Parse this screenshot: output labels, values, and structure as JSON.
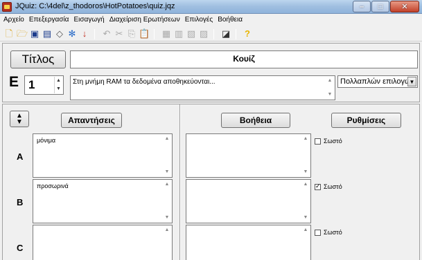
{
  "window": {
    "title": "JQuiz: C:\\4del\\z_thodoros\\HotPotatoes\\quiz.jqz",
    "minimize": "–",
    "maximize": "□",
    "close": "✕"
  },
  "menu": [
    {
      "label": "Αρχείο"
    },
    {
      "label": "Επεξεργασία"
    },
    {
      "label": "Εισαγωγή"
    },
    {
      "label": "Διαχείριση Ερωτήσεων"
    },
    {
      "label": "Επιλογές"
    },
    {
      "label": "Βοήθεια"
    }
  ],
  "toolbar": {
    "icons": [
      "new-file-icon",
      "open-folder-icon",
      "save-icon",
      "save-as-icon",
      "eraser-icon",
      "web-export-icon",
      "hot-potato-icon",
      "undo-icon",
      "cut-icon",
      "copy-icon",
      "paste-icon",
      "image-icon",
      "chart-icon",
      "add-question-icon",
      "delete-question-icon",
      "config-icon",
      "help-icon"
    ],
    "accent_red": "#c0281c",
    "accent_yellow": "#e8b400"
  },
  "quiz": {
    "title_button": "Τίτλος",
    "title_value": "Κουίζ",
    "question_letter": "Ε",
    "question_number": "1",
    "question_text": "Στη μνήμη RAM τα δεδομένα αποθηκεύονται...",
    "question_type": "Πολλαπλών επιλογών"
  },
  "answers_panel": {
    "answers_button": "Απαντήσεις",
    "feedback_button": "Βοήθεια",
    "settings_button": "Ρυθμίσεις",
    "rows": [
      {
        "letter": "A",
        "answer": "μόνιμα",
        "feedback": "",
        "correct_label": "Σωστό",
        "correct": false
      },
      {
        "letter": "B",
        "answer": "προσωρινά",
        "feedback": "",
        "correct_label": "Σωστό",
        "correct": true
      },
      {
        "letter": "C",
        "answer": "",
        "feedback": "",
        "correct_label": "Σωστό",
        "correct": false
      }
    ]
  }
}
